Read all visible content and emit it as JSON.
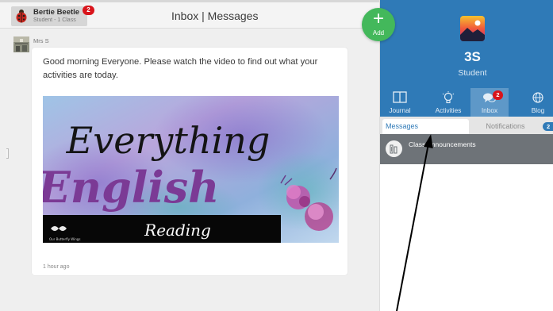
{
  "header": {
    "user_name": "Bertie Beetle",
    "user_subtitle": "Student - 1 Class",
    "notification_count": "2",
    "title": "Inbox | Messages"
  },
  "message": {
    "author": "Mrs S",
    "text": "Good morning Everyone. Please watch the video to find out what your activities are today.",
    "time": "1 hour ago",
    "banner": {
      "line1": "Everything",
      "line2": "English",
      "caption": "Reading",
      "watermark": "Our Butterfly Wings"
    }
  },
  "fab": {
    "label": "Add",
    "icon": "+"
  },
  "class_panel": {
    "name": "3S",
    "role": "Student",
    "nav": [
      {
        "label": "Journal",
        "icon": "book-icon"
      },
      {
        "label": "Activities",
        "icon": "lightbulb-icon"
      },
      {
        "label": "Inbox",
        "icon": "chat-bubbles-icon",
        "badge": "2",
        "active": true
      },
      {
        "label": "Blog",
        "icon": "globe-icon"
      }
    ]
  },
  "tabs": {
    "messages": "Messages",
    "notifications": "Notifications",
    "notifications_badge": "2"
  },
  "conversations": [
    {
      "label": "Class Announcements",
      "icon": "pencil-cup-icon"
    }
  ],
  "colors": {
    "accent_blue": "#2f7ab7",
    "active_tab": "#5e98c8",
    "add_green": "#43b85b",
    "badge_red": "#d9141b",
    "selected_item": "#6e7378"
  }
}
